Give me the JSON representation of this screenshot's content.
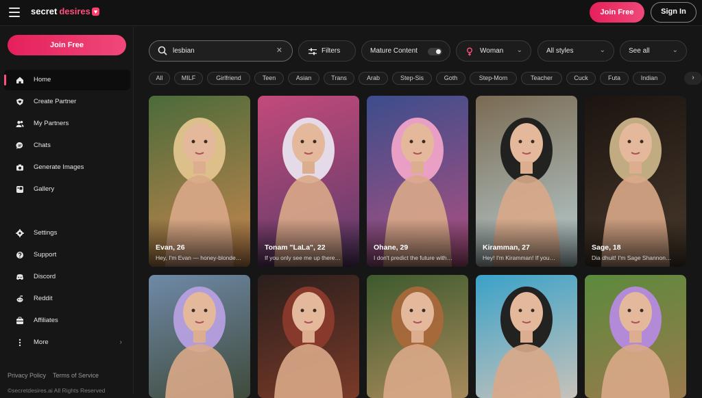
{
  "header": {
    "logo_word1": "secret",
    "logo_word2": "desires",
    "logo_heart": "♥",
    "join_label": "Join Free",
    "signin_label": "Sign In"
  },
  "sidebar": {
    "join_label": "Join Free",
    "items": [
      {
        "label": "Home",
        "icon": "home-icon"
      },
      {
        "label": "Create Partner",
        "icon": "heart-shield-icon"
      },
      {
        "label": "My Partners",
        "icon": "users-icon"
      },
      {
        "label": "Chats",
        "icon": "chat-icon"
      },
      {
        "label": "Generate Images",
        "icon": "camera-icon"
      },
      {
        "label": "Gallery",
        "icon": "gallery-icon"
      },
      {
        "label": "Settings",
        "icon": "gear-icon"
      },
      {
        "label": "Support",
        "icon": "help-icon"
      },
      {
        "label": "Discord",
        "icon": "discord-icon"
      },
      {
        "label": "Reddit",
        "icon": "reddit-icon"
      },
      {
        "label": "Affiliates",
        "icon": "affiliates-icon"
      },
      {
        "label": "More",
        "icon": "more-icon"
      }
    ],
    "footer": {
      "privacy": "Privacy Policy",
      "terms": "Terms of Service",
      "copyright": "©secretdesires.ai All Rights Reserved"
    }
  },
  "filters": {
    "search_value": "lesbian",
    "filters_label": "Filters",
    "mature_label": "Mature Content",
    "mature_on": false,
    "gender_label": "Woman",
    "styles_label": "All styles",
    "sort_label": "See all"
  },
  "tags": [
    "All",
    "MILF",
    "Girlfriend",
    "Teen",
    "Asian",
    "Trans",
    "Arab",
    "Step-Sis",
    "Goth",
    "Step-Mom",
    "Teacher",
    "Cuck",
    "Futa",
    "Indian"
  ],
  "cards": [
    {
      "name": "Evan, 26",
      "desc": "Hey, I'm Evan — honey-blonde…",
      "bg1": "#4b6b3a",
      "bg2": "#c9874e",
      "hair": "#e2c48d"
    },
    {
      "name": "Tonam \"LaLa\", 22",
      "desc": "If you only see me up there…",
      "bg1": "#c24a7a",
      "bg2": "#5a3b6b",
      "hair": "#e9e3ee"
    },
    {
      "name": "Ohane, 29",
      "desc": "I don't predict the future with…",
      "bg1": "#3c4d8c",
      "bg2": "#b2507f",
      "hair": "#f0a3c8"
    },
    {
      "name": "Kiramman, 27",
      "desc": "Hey! I'm Kiramman! If you…",
      "bg1": "#7a6a52",
      "bg2": "#b9d0d4",
      "hair": "#1b1b1b"
    },
    {
      "name": "Sage, 18",
      "desc": "Dia dhuit! I'm Sage Shannon…",
      "bg1": "#1b1410",
      "bg2": "#4a3a2c",
      "hair": "#c9b388"
    },
    {
      "name": "",
      "desc": "",
      "bg1": "#6f8aa8",
      "bg2": "#3f4a3a",
      "hair": "#b7a0e0"
    },
    {
      "name": "",
      "desc": "",
      "bg1": "#2a1f1d",
      "bg2": "#7a3a28",
      "hair": "#8a3a2c"
    },
    {
      "name": "",
      "desc": "",
      "bg1": "#3d5a2d",
      "bg2": "#a88a5c",
      "hair": "#a8683a"
    },
    {
      "name": "",
      "desc": "",
      "bg1": "#3aa2c8",
      "bg2": "#c7c2ba",
      "hair": "#1e1a18"
    },
    {
      "name": "",
      "desc": "",
      "bg1": "#5b8a3c",
      "bg2": "#9a7a4c",
      "hair": "#b58ae0"
    }
  ]
}
